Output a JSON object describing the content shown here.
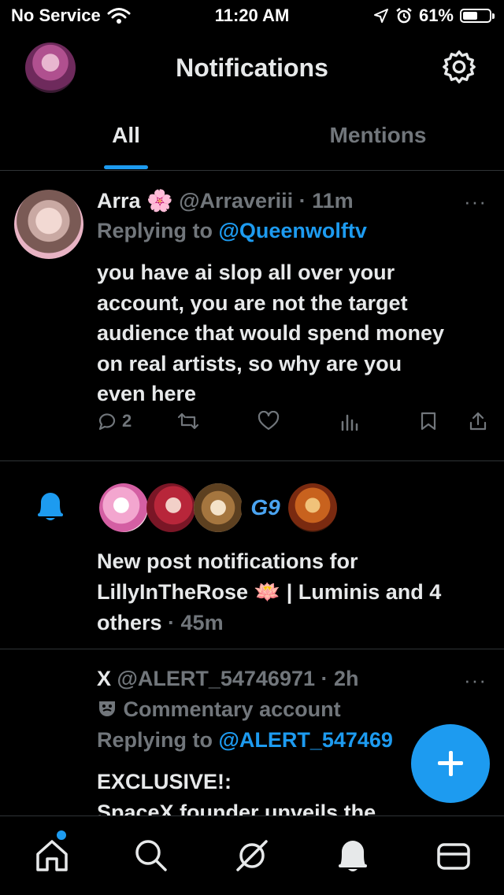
{
  "status_bar": {
    "carrier": "No Service",
    "time": "11:20 AM",
    "battery_text": "61%",
    "battery_level": 0.61
  },
  "header": {
    "title": "Notifications"
  },
  "tabs": [
    {
      "label": "All"
    },
    {
      "label": "Mentions"
    }
  ],
  "notif1": {
    "name": "Arra",
    "emoji": "🌸",
    "handle": "@Arraveriii",
    "time": "· 11m",
    "reply_prefix": "Replying to",
    "reply_handle": "@Queenwolftv",
    "text_lines": [
      "you have ai slop all over your",
      "account, you are not the target",
      "audience that would spend money",
      "on real artists, so why are you",
      "even here"
    ],
    "reply_count": "2",
    "more": "···"
  },
  "notif2": {
    "line1": "New post notifications for",
    "line2_a": "LillyInTheRose",
    "line2_emoji": "🪷",
    "line2_b": "| Luminis and 4",
    "line3": "others",
    "time": "· 45m",
    "avatar_badge": "G9"
  },
  "notif3": {
    "name": "X",
    "handle": "@ALERT_54746971",
    "time": "· 2h",
    "label_icon": "theater-mask-icon",
    "label": "Commentary account",
    "reply_prefix": "Replying to",
    "reply_handle": "@ALERT_547469",
    "text_lines": [
      "EXCLUSIVE!:",
      "SpaceX founder unveils the"
    ],
    "more": "···"
  },
  "colors": {
    "accent": "#1d9bf0",
    "muted": "#71767b",
    "text": "#e7e9ea",
    "background": "#000000",
    "divider": "#2f3336"
  }
}
